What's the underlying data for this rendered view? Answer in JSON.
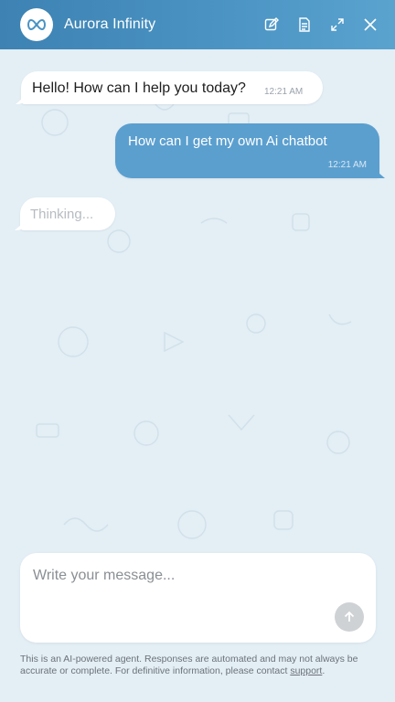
{
  "header": {
    "title": "Aurora Infinity",
    "actions": [
      {
        "name": "edit-icon"
      },
      {
        "name": "document-icon"
      },
      {
        "name": "expand-icon"
      },
      {
        "name": "close-icon"
      }
    ]
  },
  "messages": [
    {
      "role": "bot",
      "text": "Hello! How can I help you today?",
      "time": "12:21 AM"
    },
    {
      "role": "user",
      "text": "How can I get my own Ai chatbot",
      "time": "12:21 AM"
    },
    {
      "role": "bot",
      "text": "Thinking..."
    }
  ],
  "composer": {
    "placeholder": "Write your message...",
    "send_icon": "arrow-up-icon"
  },
  "disclaimer": {
    "text": "This is an AI-powered agent. Responses are automated and may not always be accurate or complete. For definitive information, please contact ",
    "link": "support",
    "end": "."
  },
  "colors": {
    "header": "#4a93c3",
    "user_bubble": "#5b9fcf",
    "background": "#e3eef5"
  }
}
